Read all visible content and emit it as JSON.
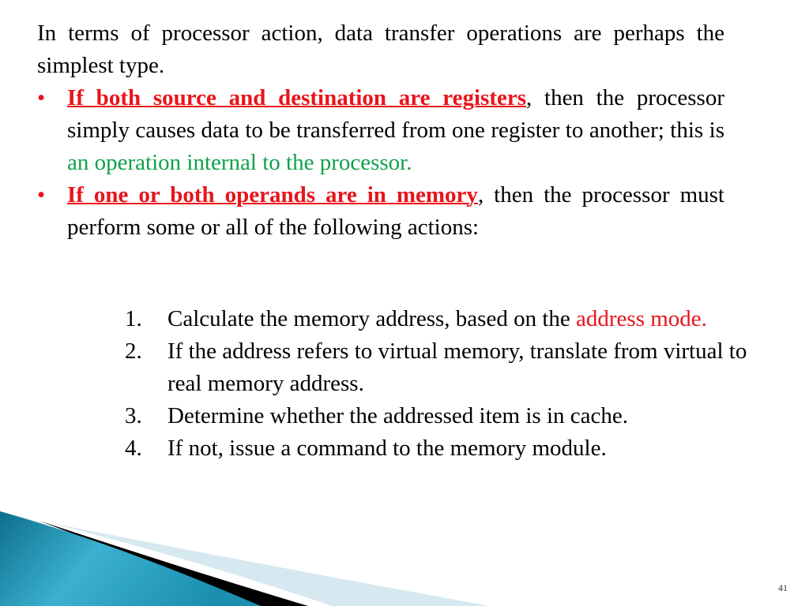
{
  "intro": {
    "text": "In terms of processor action, data transfer operations are perhaps the simplest type."
  },
  "bullets": [
    {
      "highlight": "If both source and destination are registers",
      "text_after": ", then the processor simply causes data to be transferred from one register to another; this is ",
      "green_text": "an operation internal to the processor."
    },
    {
      "highlight": "If one or both operands are in memory",
      "text_after": ", then the processor must perform some or all of the following actions:"
    }
  ],
  "actions": [
    {
      "num": "1.",
      "text": "Calculate the memory address, based on the ",
      "red_text": "address mode."
    },
    {
      "num": "2.",
      "text": "If the address refers to virtual memory, translate from virtual to real memory address."
    },
    {
      "num": "3.",
      "text": "Determine whether the addressed item is in cache."
    },
    {
      "num": "4.",
      "text": "If not, issue a command to the memory module."
    }
  ],
  "page_number": "41",
  "colors": {
    "accent_red": "#e8141b",
    "accent_green": "#0fa14a",
    "decor_teal": "#1a8fb0"
  }
}
